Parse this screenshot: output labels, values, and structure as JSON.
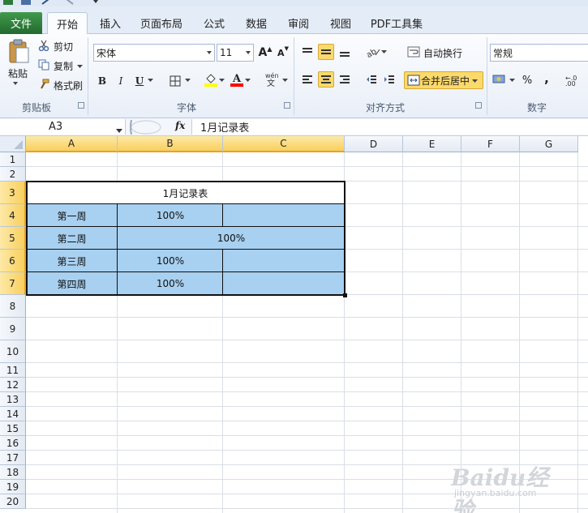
{
  "tabs": {
    "file": "文件",
    "items": [
      "开始",
      "插入",
      "页面布局",
      "公式",
      "数据",
      "审阅",
      "视图",
      "PDF工具集"
    ],
    "active": "开始"
  },
  "ribbon": {
    "clipboard": {
      "paste": "粘贴",
      "cut": "剪切",
      "copy": "复制",
      "format_painter": "格式刷",
      "label": "剪贴板"
    },
    "font": {
      "name": "宋体",
      "size": "11",
      "bold": "B",
      "italic": "I",
      "underline": "U",
      "label": "字体",
      "fill_color": "#ffff00",
      "font_color": "#ff0000"
    },
    "alignment": {
      "wrap_text": "自动换行",
      "merge_center": "合并后居中",
      "label": "对齐方式"
    },
    "number": {
      "format": "常规",
      "percent": "%",
      "comma": ",",
      "label": "数字"
    }
  },
  "formula_bar": {
    "name_box": "A3",
    "fx": "fx",
    "formula": "1月记录表"
  },
  "sheet": {
    "columns": [
      "A",
      "B",
      "C",
      "D",
      "E",
      "F",
      "G"
    ],
    "rows": [
      "1",
      "2",
      "3",
      "4",
      "5",
      "6",
      "7",
      "8",
      "9",
      "10",
      "11",
      "12",
      "13",
      "14",
      "15",
      "16",
      "17",
      "18",
      "19",
      "20"
    ],
    "selected_columns": [
      "A",
      "B",
      "C"
    ],
    "selected_rows": [
      "3",
      "4",
      "5",
      "6",
      "7"
    ],
    "title": "1月记录表",
    "table": [
      {
        "label": "第一周",
        "value": "100%",
        "merged": false
      },
      {
        "label": "第二周",
        "value": "100%",
        "merged": true
      },
      {
        "label": "第三周",
        "value": "100%",
        "merged": false
      },
      {
        "label": "第四周",
        "value": "100%",
        "merged": false
      }
    ],
    "fill_color": "#a8d0f0"
  },
  "watermark": {
    "brand": "Baidu经验",
    "url": "jingyan.baidu.com"
  }
}
